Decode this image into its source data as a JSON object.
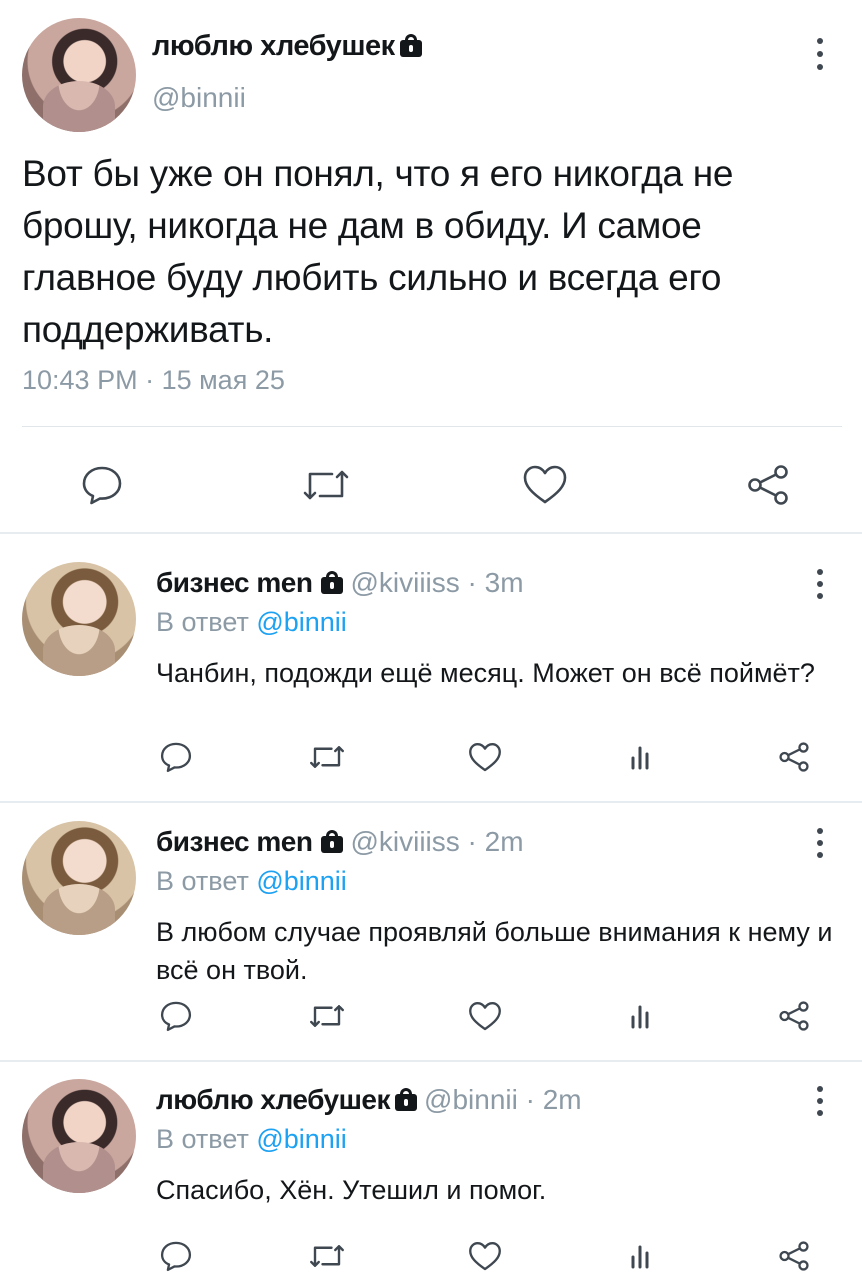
{
  "main_tweet": {
    "display_name": "люблю хлебушек",
    "handle": "@binnii",
    "text": "Вот бы уже он понял, что я его никогда не брошу, никогда не дам в обиду. И самое главное буду любить сильно и всегда его поддерживать.",
    "time": "10:43 PM",
    "meta_sep": " · ",
    "date": "15 мая 25",
    "icons": [
      "reply-icon",
      "retweet-icon",
      "like-icon",
      "share-icon"
    ]
  },
  "replies": [
    {
      "display_name": "бизнес men",
      "handle": "@kiviiiss",
      "sep": " · ",
      "time": "3m",
      "reply_prefix": "В ответ ",
      "reply_to": "@binnii",
      "text": "Чанбин, подожди ещё месяц. Может он всё поймёт?"
    },
    {
      "display_name": "бизнес men",
      "handle": "@kiviiiss",
      "sep": " · ",
      "time": "2m",
      "reply_prefix": "В ответ ",
      "reply_to": "@binnii",
      "text": "В любом случае проявляй больше внимания к нему и всё он твой."
    },
    {
      "display_name": "люблю хлебушек",
      "handle": "@binnii",
      "sep": " · ",
      "time": "2m",
      "reply_prefix": "В ответ ",
      "reply_to": "@binnii",
      "text": "Спасибо, Хён. Утешил и помог."
    }
  ],
  "colors": {
    "text": "#14171a",
    "secondary": "#8c9aa5",
    "link": "#1da1f2",
    "divider": "#e6ecf0"
  }
}
